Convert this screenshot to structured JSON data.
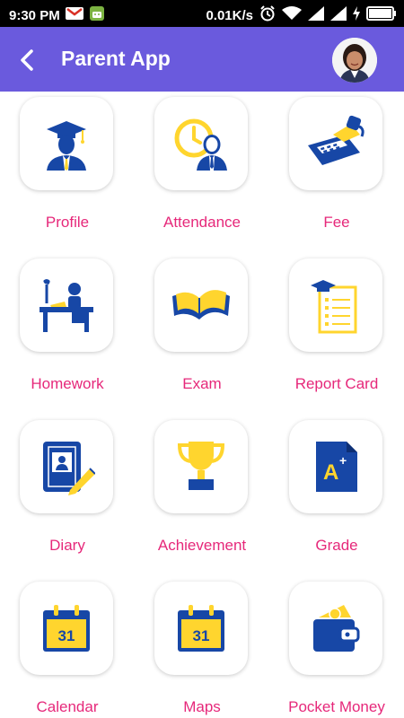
{
  "status_bar": {
    "time": "9:30 PM",
    "speed": "0.01K/s",
    "icons": [
      "gmail-icon",
      "android-icon",
      "alarm-icon",
      "wifi-icon",
      "signal-icon",
      "signal-icon",
      "charging-icon",
      "battery-icon"
    ]
  },
  "app_bar": {
    "title": "Parent App",
    "back_icon": "chevron-left-icon",
    "avatar": "profile-photo"
  },
  "menu": {
    "items": [
      {
        "label": "Profile",
        "icon": "graduate-icon"
      },
      {
        "label": "Attendance",
        "icon": "clock-person-icon"
      },
      {
        "label": "Fee",
        "icon": "calculator-icon"
      },
      {
        "label": "Homework",
        "icon": "desk-study-icon"
      },
      {
        "label": "Exam",
        "icon": "open-book-icon"
      },
      {
        "label": "Report Card",
        "icon": "report-card-icon"
      },
      {
        "label": "Diary",
        "icon": "diary-pencil-icon"
      },
      {
        "label": "Achievement",
        "icon": "trophy-icon"
      },
      {
        "label": "Grade",
        "icon": "grade-a-plus-icon"
      },
      {
        "label": "Calendar",
        "icon": "calendar-icon"
      },
      {
        "label": "Maps",
        "icon": "calendar-icon"
      },
      {
        "label": "Pocket Money",
        "icon": "wallet-icon"
      }
    ],
    "calendar_day": "31",
    "grade_text": "A",
    "grade_sup": "+"
  },
  "colors": {
    "app_bar": "#6a5add",
    "label": "#e6287a",
    "icon_blue": "#1747a6",
    "icon_yellow": "#ffd52e"
  }
}
